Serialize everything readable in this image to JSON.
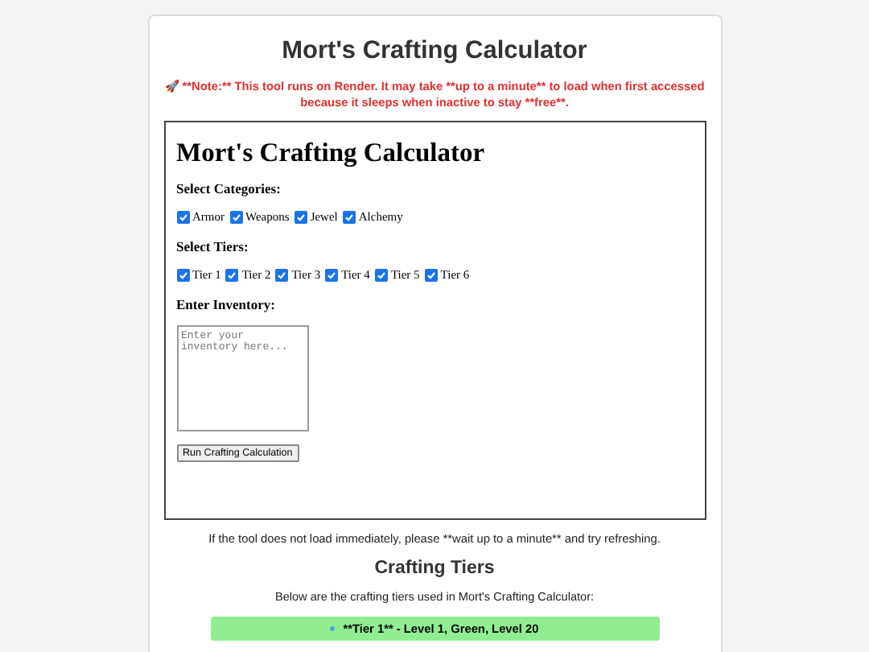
{
  "title": "Mort's Crafting Calculator",
  "note": "🚀 **Note:** This tool runs on Render. It may take **up to a minute** to load when first accessed because it sleeps when inactive to stay **free**.",
  "embed": {
    "heading": "Mort's Crafting Calculator",
    "sections": [
      {
        "kind": "checks",
        "label": "Select Categories:",
        "options": [
          {
            "label": "Armor",
            "checked": true
          },
          {
            "label": "Weapons",
            "checked": true
          },
          {
            "label": "Jewel",
            "checked": true
          },
          {
            "label": "Alchemy",
            "checked": true
          }
        ]
      },
      {
        "kind": "checks",
        "label": "Select Tiers:",
        "options": [
          {
            "label": "Tier 1",
            "checked": true
          },
          {
            "label": "Tier 2",
            "checked": true
          },
          {
            "label": "Tier 3",
            "checked": true
          },
          {
            "label": "Tier 4",
            "checked": true
          },
          {
            "label": "Tier 5",
            "checked": true
          },
          {
            "label": "Tier 6",
            "checked": true
          }
        ]
      },
      {
        "kind": "textarea",
        "label": "Enter Inventory:",
        "placeholder": "Enter your inventory here..."
      }
    ],
    "button": "Run Crafting Calculation"
  },
  "hint": "If the tool does not load immediately, please **wait up to a minute** and try refreshing.",
  "tiers_heading": "Crafting Tiers",
  "tiers_intro": "Below are the crafting tiers used in Mort's Crafting Calculator:",
  "tiers": [
    {
      "text": "**Tier 1** - Level 1, Green, Level 20",
      "color": "#90ee90"
    }
  ]
}
